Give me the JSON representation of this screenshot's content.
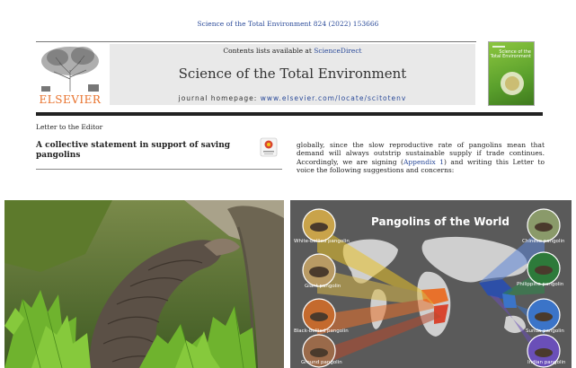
{
  "header": {
    "citation": "Science of the Total Environment 824 (2022) 153666",
    "contents_prefix": "Contents lists available at ",
    "contents_link": "ScienceDirect",
    "journal_title": "Science of the Total Environment",
    "homepage_prefix": "journal homepage: ",
    "homepage_url": "www.elsevier.com/locate/scitotenv",
    "publisher_logo_text": "ELSEVIER",
    "cover_title": "Science of the Total Environment"
  },
  "article": {
    "section": "Letter to the Editor",
    "title": "A collective statement in support of saving pangolins",
    "body_before_link": "globally, since the slow reproductive rate of pangolins mean that demand will always outstrip sustainable supply if trade continues. Accordingly, we are signing (",
    "body_link": "Appendix 1",
    "body_after_link": ") and writing this Letter to voice the following suggestions and concerns:"
  },
  "figure": {
    "map_title": "Pangolins of the World",
    "species_left": [
      "White-bellied pangolin",
      "Giant pangolin",
      "Black-bellied pangolin",
      "Ground pangolin"
    ],
    "species_right": [
      "Chinese pangolin",
      "Philippine pangolin",
      "Sunda pangolin",
      "Indian pangolin"
    ]
  },
  "colors": {
    "link": "#2a4a99",
    "elsevier_orange": "#e8712b",
    "map_background": "#5a5a5a",
    "ocean_circle_yellow": "#e8c22a",
    "ocean_circle_blue": "#2d4fa8"
  }
}
